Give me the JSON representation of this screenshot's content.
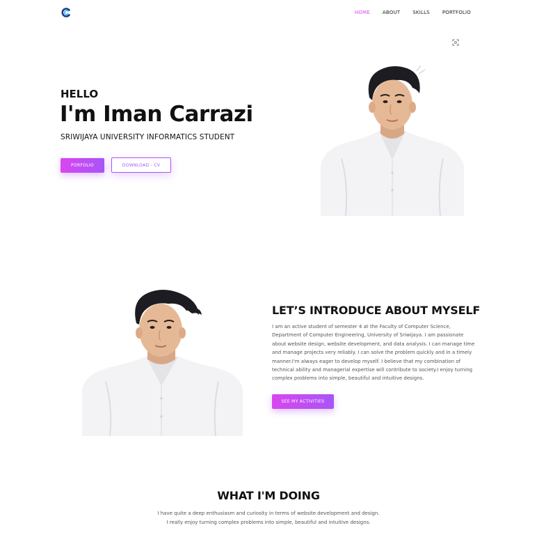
{
  "nav": {
    "items": [
      "HOME",
      "ABOUT",
      "SKILLS",
      "PORTFOLIO"
    ],
    "active": "HOME"
  },
  "hero": {
    "hello": "HELLO",
    "name": "I'm Iman Carrazi",
    "subtitle": "SRIWIJAYA UNIVERSITY INFORMATICS STUDENT",
    "primary_button": "PORFOLIO",
    "secondary_button": "DOWNLOAD - CV"
  },
  "about": {
    "title": "LET’S INTRODUCE ABOUT MYSELF",
    "paragraph": "I am an active student of semester 4 at the Faculty of Computer Science, Department of Computer Engineering, University of Sriwijaya. I am passionate about website design, website development, and data analysis. I can manage time and manage projects very reliably. I can solve the problem quickly and in a timely manner.I'm always eager to develop myself. I believe that my combination of technical ability and managerial expertise will contribute to society.I enjoy turning complex problems into simple, beautiful and intuitive designs.",
    "button": "SEE MY ACTIVITIES"
  },
  "doing": {
    "title": "WHAT I'M DOING",
    "line1": "I have quite a deep enthusiasm and curiosity in terms of website development and design.",
    "line2": "I really enjoy turning complex problems into simple, beautiful and intuitive designs."
  },
  "colors": {
    "accent": "#d946ef",
    "accent2": "#a855f7",
    "logo": "#1e40af"
  },
  "icons": {
    "logo": "logo-c-icon",
    "scan": "scan-icon"
  }
}
